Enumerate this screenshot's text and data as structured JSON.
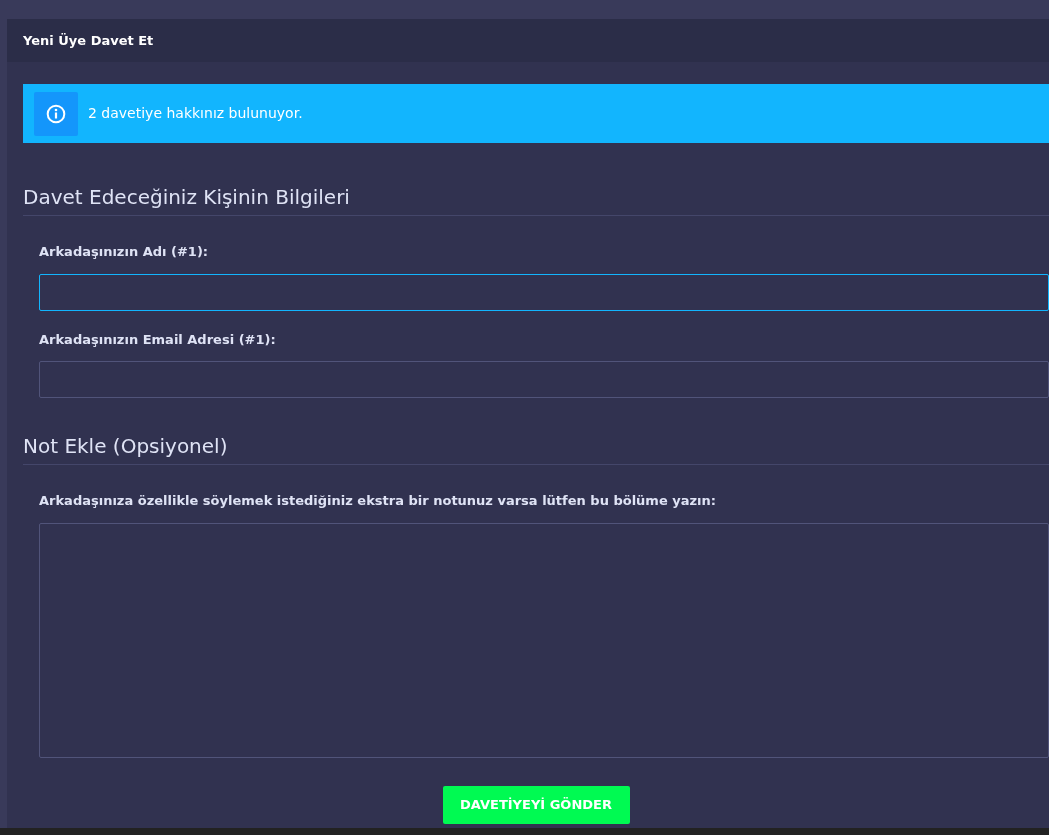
{
  "panel": {
    "title": "Yeni Üye Davet Et"
  },
  "alert": {
    "text": "2 davetiye hakkınız bulunuyor."
  },
  "sections": [
    {
      "heading": "Davet Edeceğiniz Kişinin Bilgileri",
      "fields": [
        {
          "kind": "input",
          "label": "Arkadaşınızın Adı (#1):",
          "focused": true
        },
        {
          "kind": "input",
          "label": "Arkadaşınızın Email Adresi (#1):",
          "focused": false
        }
      ]
    },
    {
      "heading": "Not Ekle (Opsiyonel)",
      "fields": [
        {
          "kind": "textarea",
          "label": "Arkadaşınıza özellikle söylemek istediğiniz ekstra bir notunuz varsa lütfen bu bölüme yazın:",
          "focused": false
        }
      ]
    }
  ],
  "submit": {
    "label": "DAVETİYEYİ GÖNDER"
  }
}
